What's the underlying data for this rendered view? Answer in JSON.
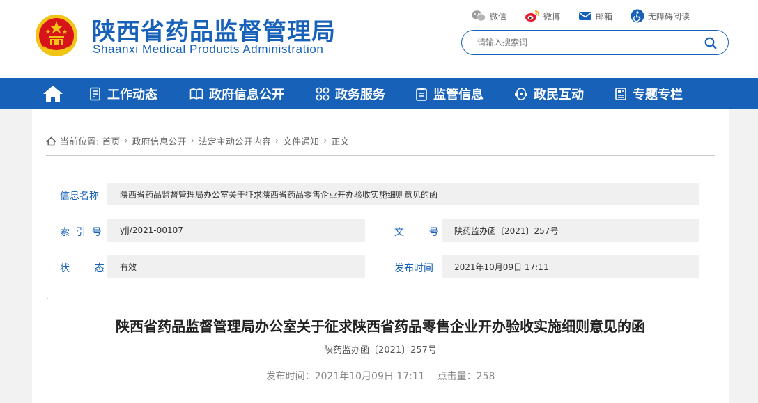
{
  "header": {
    "title_cn": "陕西省药品监督管理局",
    "title_en": "Shaanxi Medical Products Administration",
    "top_links": [
      {
        "label": "微信",
        "icon": "wechat-icon"
      },
      {
        "label": "微博",
        "icon": "weibo-icon"
      },
      {
        "label": "邮箱",
        "icon": "mail-icon"
      },
      {
        "label": "无障碍阅读",
        "icon": "accessibility-icon"
      }
    ],
    "search": {
      "placeholder": "请输入搜索词",
      "value": ""
    }
  },
  "nav": {
    "items": [
      {
        "label": "工作动态",
        "icon": "document-list-icon"
      },
      {
        "label": "政府信息公开",
        "icon": "open-book-icon"
      },
      {
        "label": "政务服务",
        "icon": "grid-circles-icon"
      },
      {
        "label": "监管信息",
        "icon": "clipboard-icon"
      },
      {
        "label": "政民互动",
        "icon": "interaction-icon"
      },
      {
        "label": "专题专栏",
        "icon": "column-icon"
      }
    ]
  },
  "breadcrumb": {
    "prefix": "当前位置:",
    "items": [
      "首页",
      "政府信息公开",
      "法定主动公开内容",
      "文件通知",
      "正文"
    ]
  },
  "info": {
    "name_label": "信息名称",
    "name_value": "陕西省药品监督管理局办公室关于征求陕西省药品零售企业开办验收实施细则意见的函",
    "index_label": "索  引  号",
    "index_value": "yjj/2021-00107",
    "docno_label": "文        号",
    "docno_value": "陕药监办函〔2021〕257号",
    "status_label": "状        态",
    "status_value": "有效",
    "time_label": "发布时间",
    "time_value": "2021年10月09日 17:11"
  },
  "article": {
    "dot": ".",
    "title": "陕西省药品监督管理局办公室关于征求陕西省药品零售企业开办验收实施细则意见的函",
    "doc_number": "陕药监办函〔2021〕257号",
    "publish_time": "发布时间：2021年10月09日 17:11",
    "clicks": "点击量：258"
  },
  "colors": {
    "brand": "#1762b8",
    "emblem_red": "#d7141a",
    "emblem_gold": "#f2c416"
  }
}
